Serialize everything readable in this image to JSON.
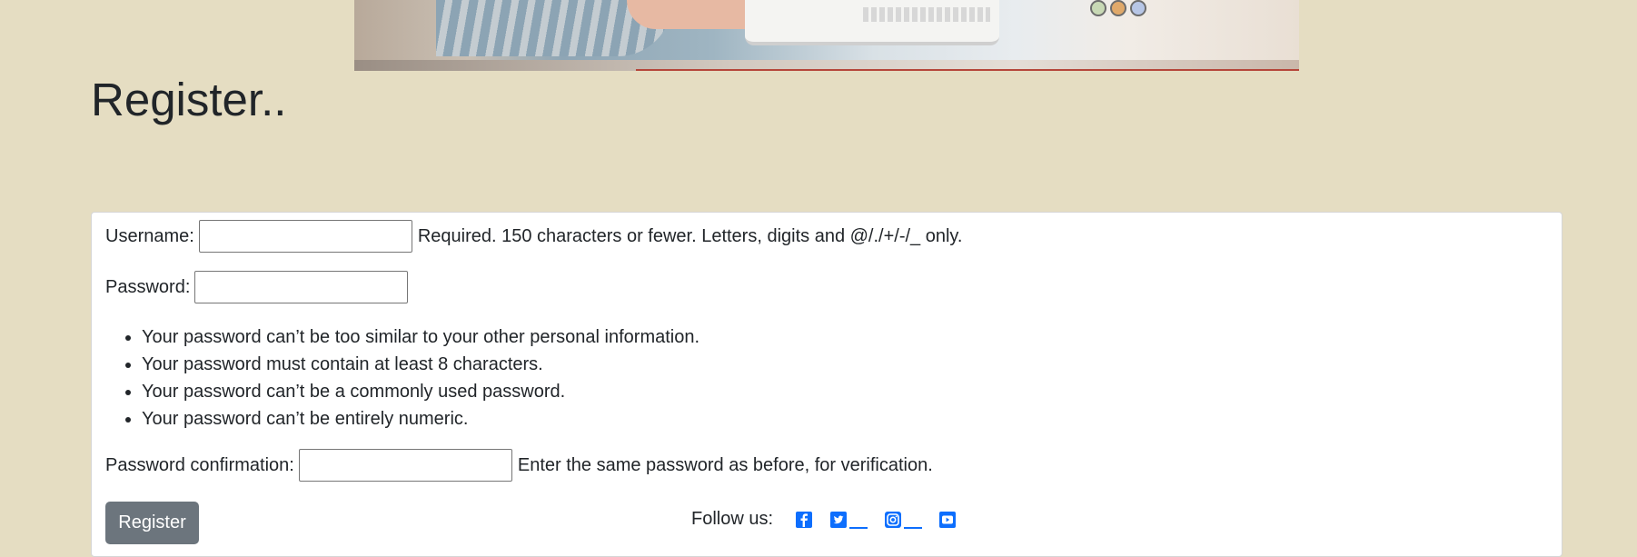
{
  "page": {
    "title": "Register.."
  },
  "form": {
    "username": {
      "label": "Username:",
      "value": "",
      "help": "Required. 150 characters or fewer. Letters, digits and @/./+/-/_ only."
    },
    "password": {
      "label": "Password:",
      "value": "",
      "rules": [
        "Your password can’t be too similar to your other personal information.",
        "Your password must contain at least 8 characters.",
        "Your password can’t be a commonly used password.",
        "Your password can’t be entirely numeric."
      ]
    },
    "password_confirmation": {
      "label": "Password confirmation:",
      "value": "",
      "help": "Enter the same password as before, for verification."
    },
    "submit_label": "Register"
  },
  "footer": {
    "follow_label": "Follow us:",
    "social_icons": [
      "facebook-icon",
      "twitter-icon",
      "instagram-icon",
      "youtube-icon"
    ]
  },
  "colors": {
    "background": "#e5ddc2",
    "button": "#6c757d",
    "link": "#0d6efd"
  }
}
